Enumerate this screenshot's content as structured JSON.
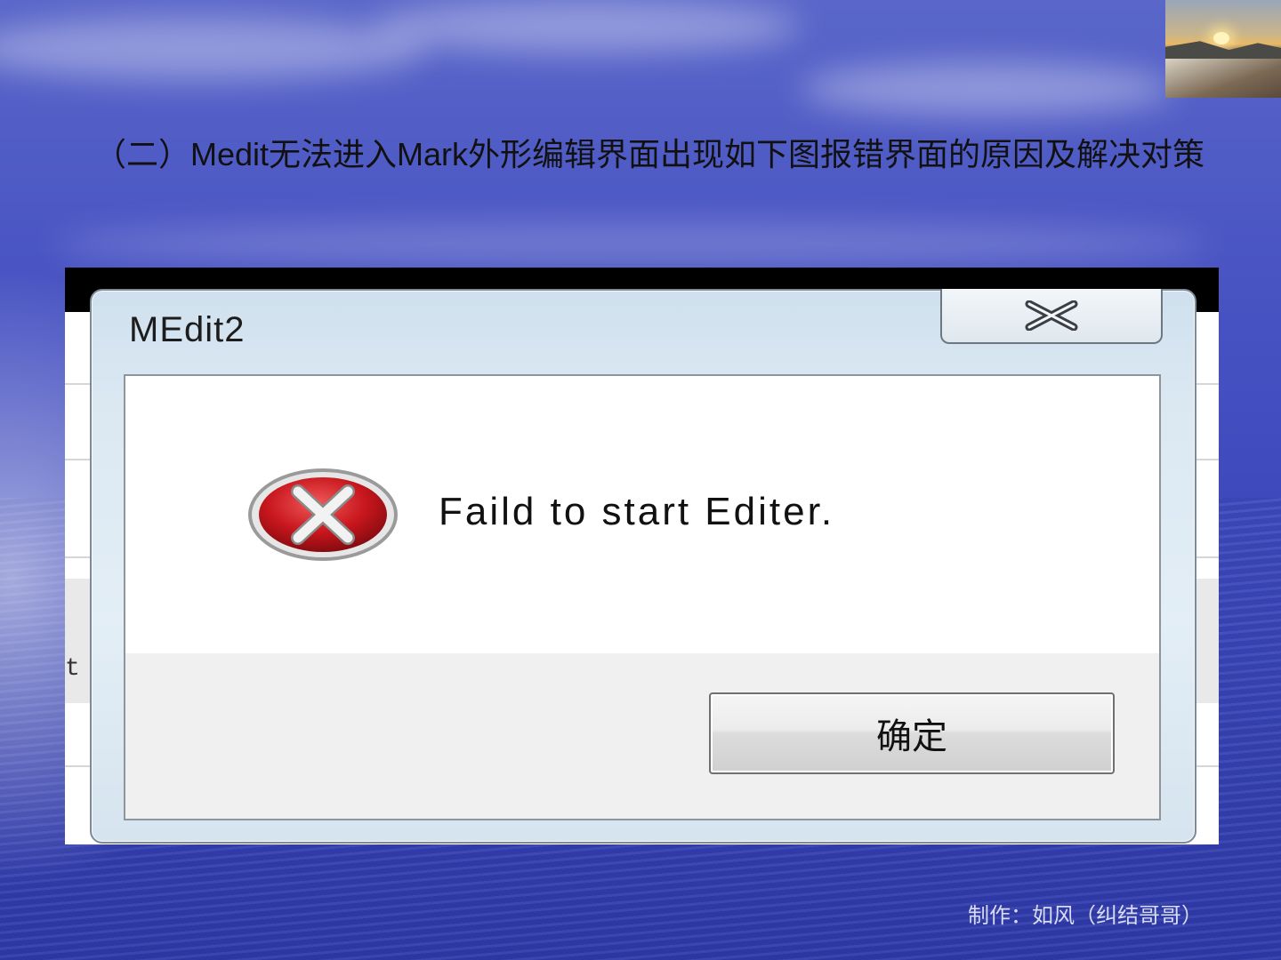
{
  "slide": {
    "title": "（二）Medit无法进入Mark外形编辑界面出现如下图报错界面的原因及解决对策",
    "footer": "制作：如风（纠结哥哥）",
    "background_colors": [
      "#5a67c9",
      "#3f4bbd",
      "#2f3aa8"
    ]
  },
  "dialog": {
    "title": "MEdit2",
    "close_icon": "close-icon",
    "error_icon": "error-x-icon",
    "message": "Faild to start Editer.",
    "ok_label": "确定",
    "accent_color": "#c8161d"
  },
  "background_window": {
    "edge_text": "t"
  }
}
